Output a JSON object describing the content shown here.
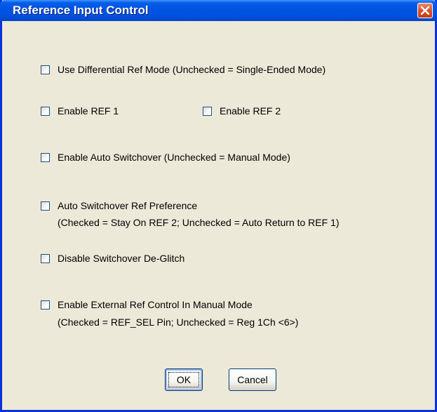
{
  "dialog": {
    "title": "Reference Input Control"
  },
  "options": {
    "differential": {
      "label": "Use Differential Ref Mode (Unchecked = Single-Ended Mode)",
      "checked": false
    },
    "ref1": {
      "label": "Enable REF 1",
      "checked": false
    },
    "ref2": {
      "label": "Enable REF 2",
      "checked": false
    },
    "auto_switchover": {
      "label": "Enable Auto Switchover (Unchecked = Manual Mode)",
      "checked": false
    },
    "auto_pref": {
      "label": "Auto Switchover Ref Preference",
      "sub": "(Checked = Stay On REF 2; Unchecked = Auto Return to REF 1)",
      "checked": false
    },
    "deglitch": {
      "label": "Disable Switchover De-Glitch",
      "checked": false
    },
    "ext_ref": {
      "label": "Enable External Ref Control In Manual Mode",
      "sub": "(Checked = REF_SEL Pin; Unchecked = Reg 1Ch <6>)",
      "checked": false
    }
  },
  "buttons": {
    "ok": "OK",
    "cancel": "Cancel"
  },
  "icons": {
    "close": "close-icon"
  },
  "colors": {
    "titlebar": "#0054e3",
    "window_bg": "#ece9d8",
    "close_button": "#d8542c"
  }
}
